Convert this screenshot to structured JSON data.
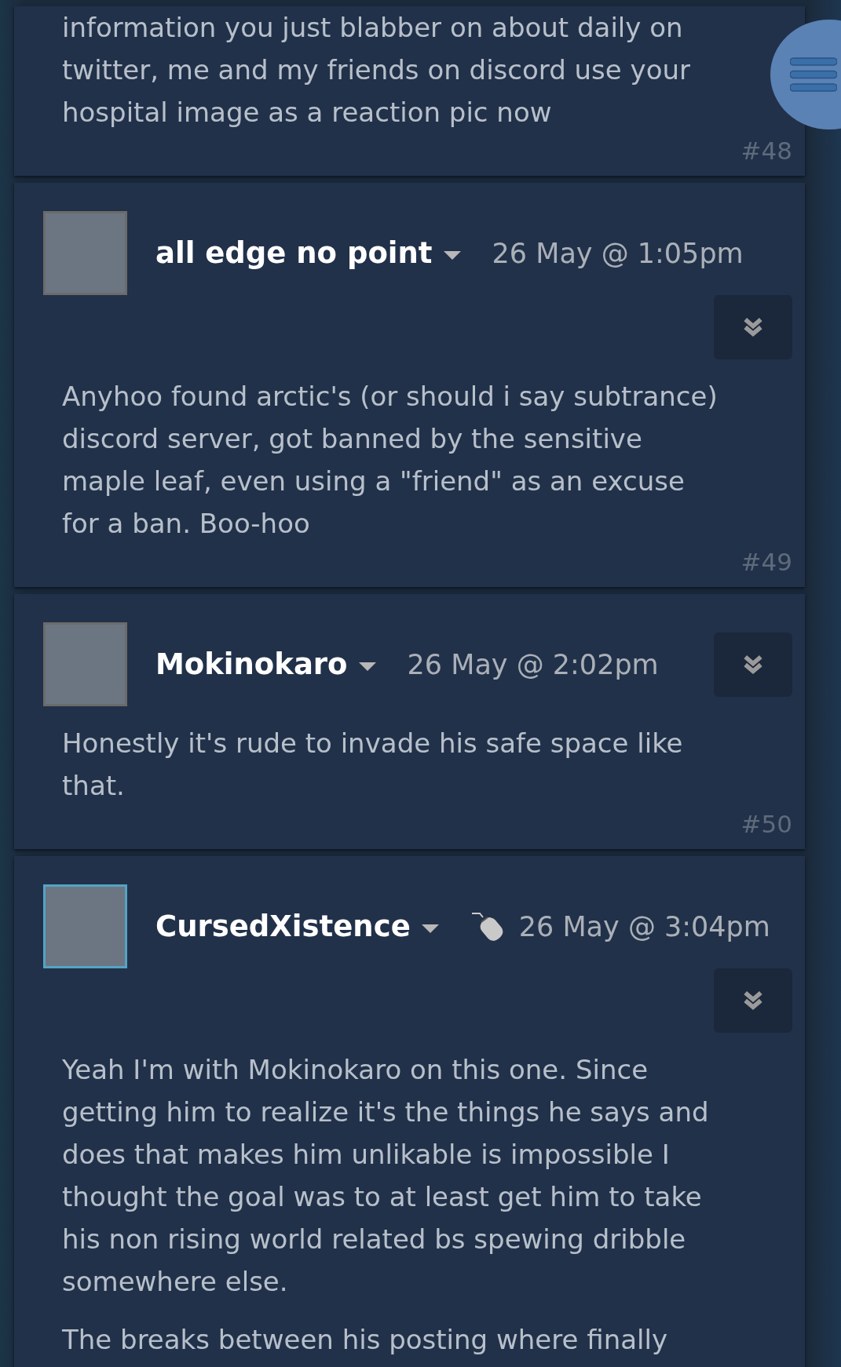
{
  "posts": [
    {
      "paragraphs": [
        "information you just blabber on about daily on twitter, me and my friends on discord use your hospital image as a reaction pic now"
      ],
      "number": "#48"
    },
    {
      "author": {
        "name": "all edge no point",
        "online": false,
        "has_badge": false
      },
      "timestamp": "26 May @ 1:05pm",
      "paragraphs": [
        "Anyhoo found arctic's (or should i say subtrance) discord server, got banned by the sensitive maple leaf, even using a \"friend\" as an excuse for a ban. Boo-hoo"
      ],
      "number": "#49"
    },
    {
      "author": {
        "name": "Mokinokaro",
        "online": false,
        "has_badge": false
      },
      "timestamp": "26 May @ 2:02pm",
      "paragraphs": [
        "Honestly it's rude to invade his safe space like that."
      ],
      "number": "#50"
    },
    {
      "author": {
        "name": "CursedXistence",
        "online": true,
        "has_badge": true
      },
      "timestamp": "26 May @ 3:04pm",
      "paragraphs": [
        "Yeah I'm with Mokinokaro on this one. Since getting him to realize it's the things he says and does that makes him unlikable is impossible I thought the goal was to at least get him to take his non rising world related bs spewing dribble somewhere else.",
        "The breaks between his posting where finally"
      ]
    }
  ]
}
